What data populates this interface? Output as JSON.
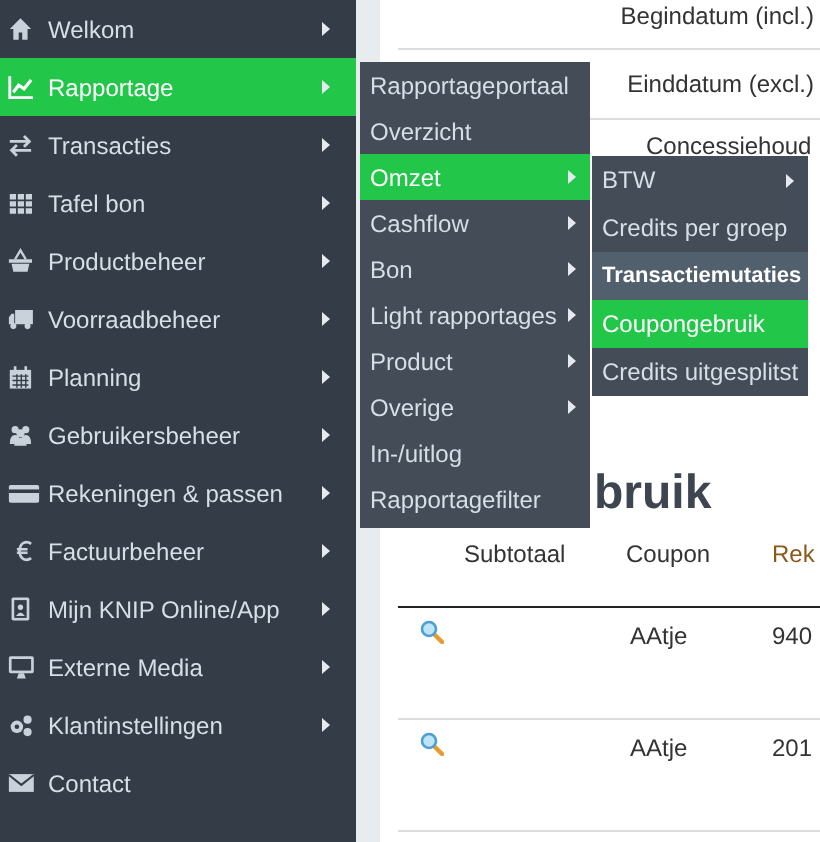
{
  "sidebar": {
    "items": [
      {
        "label": "Welkom",
        "has_submenu": true,
        "selected": false
      },
      {
        "label": "Rapportage",
        "has_submenu": true,
        "selected": true
      },
      {
        "label": "Transacties",
        "has_submenu": true,
        "selected": false
      },
      {
        "label": "Tafel bon",
        "has_submenu": true,
        "selected": false
      },
      {
        "label": "Productbeheer",
        "has_submenu": true,
        "selected": false
      },
      {
        "label": "Voorraadbeheer",
        "has_submenu": true,
        "selected": false
      },
      {
        "label": "Planning",
        "has_submenu": true,
        "selected": false
      },
      {
        "label": "Gebruikersbeheer",
        "has_submenu": true,
        "selected": false
      },
      {
        "label": "Rekeningen & passen",
        "has_submenu": true,
        "selected": false
      },
      {
        "label": "Factuurbeheer",
        "has_submenu": true,
        "selected": false
      },
      {
        "label": "Mijn KNIP Online/App",
        "has_submenu": true,
        "selected": false
      },
      {
        "label": "Externe Media",
        "has_submenu": true,
        "selected": false
      },
      {
        "label": "Klantinstellingen",
        "has_submenu": true,
        "selected": false
      },
      {
        "label": "Contact",
        "has_submenu": false,
        "selected": false
      }
    ]
  },
  "submenu": {
    "items": [
      {
        "label": "Rapportageportaal",
        "has_submenu": false,
        "selected": false
      },
      {
        "label": "Overzicht",
        "has_submenu": false,
        "selected": false
      },
      {
        "label": "Omzet",
        "has_submenu": true,
        "selected": true
      },
      {
        "label": "Cashflow",
        "has_submenu": true,
        "selected": false
      },
      {
        "label": "Bon",
        "has_submenu": true,
        "selected": false
      },
      {
        "label": "Light rapportages",
        "has_submenu": true,
        "selected": false
      },
      {
        "label": "Product",
        "has_submenu": true,
        "selected": false
      },
      {
        "label": "Overige",
        "has_submenu": true,
        "selected": false
      },
      {
        "label": "In-/uitlog",
        "has_submenu": false,
        "selected": false
      },
      {
        "label": "Rapportagefilter",
        "has_submenu": false,
        "selected": false
      }
    ]
  },
  "subsubmenu": {
    "items": [
      {
        "label": "BTW",
        "has_submenu": true,
        "selected": false,
        "hovered": false
      },
      {
        "label": "Credits per groep",
        "has_submenu": false,
        "selected": false,
        "hovered": false
      },
      {
        "label": "Transactiemutaties",
        "has_submenu": false,
        "selected": false,
        "hovered": true
      },
      {
        "label": "Coupongebruik",
        "has_submenu": false,
        "selected": true,
        "hovered": false
      },
      {
        "label": "Credits uitgesplitst",
        "has_submenu": false,
        "selected": false,
        "hovered": false
      }
    ]
  },
  "filters": [
    "Begindatum (incl.)",
    "Einddatum (excl.)",
    "Concessiehoud"
  ],
  "heading": "bruik",
  "table": {
    "columns": [
      "",
      "Subtotaal",
      "Coupon",
      "Rek"
    ],
    "rows": [
      {
        "subtotal": "",
        "coupon": "AAtje",
        "column_4": "940"
      },
      {
        "subtotal": "",
        "coupon": "AAtje",
        "column_4": "201"
      }
    ]
  }
}
